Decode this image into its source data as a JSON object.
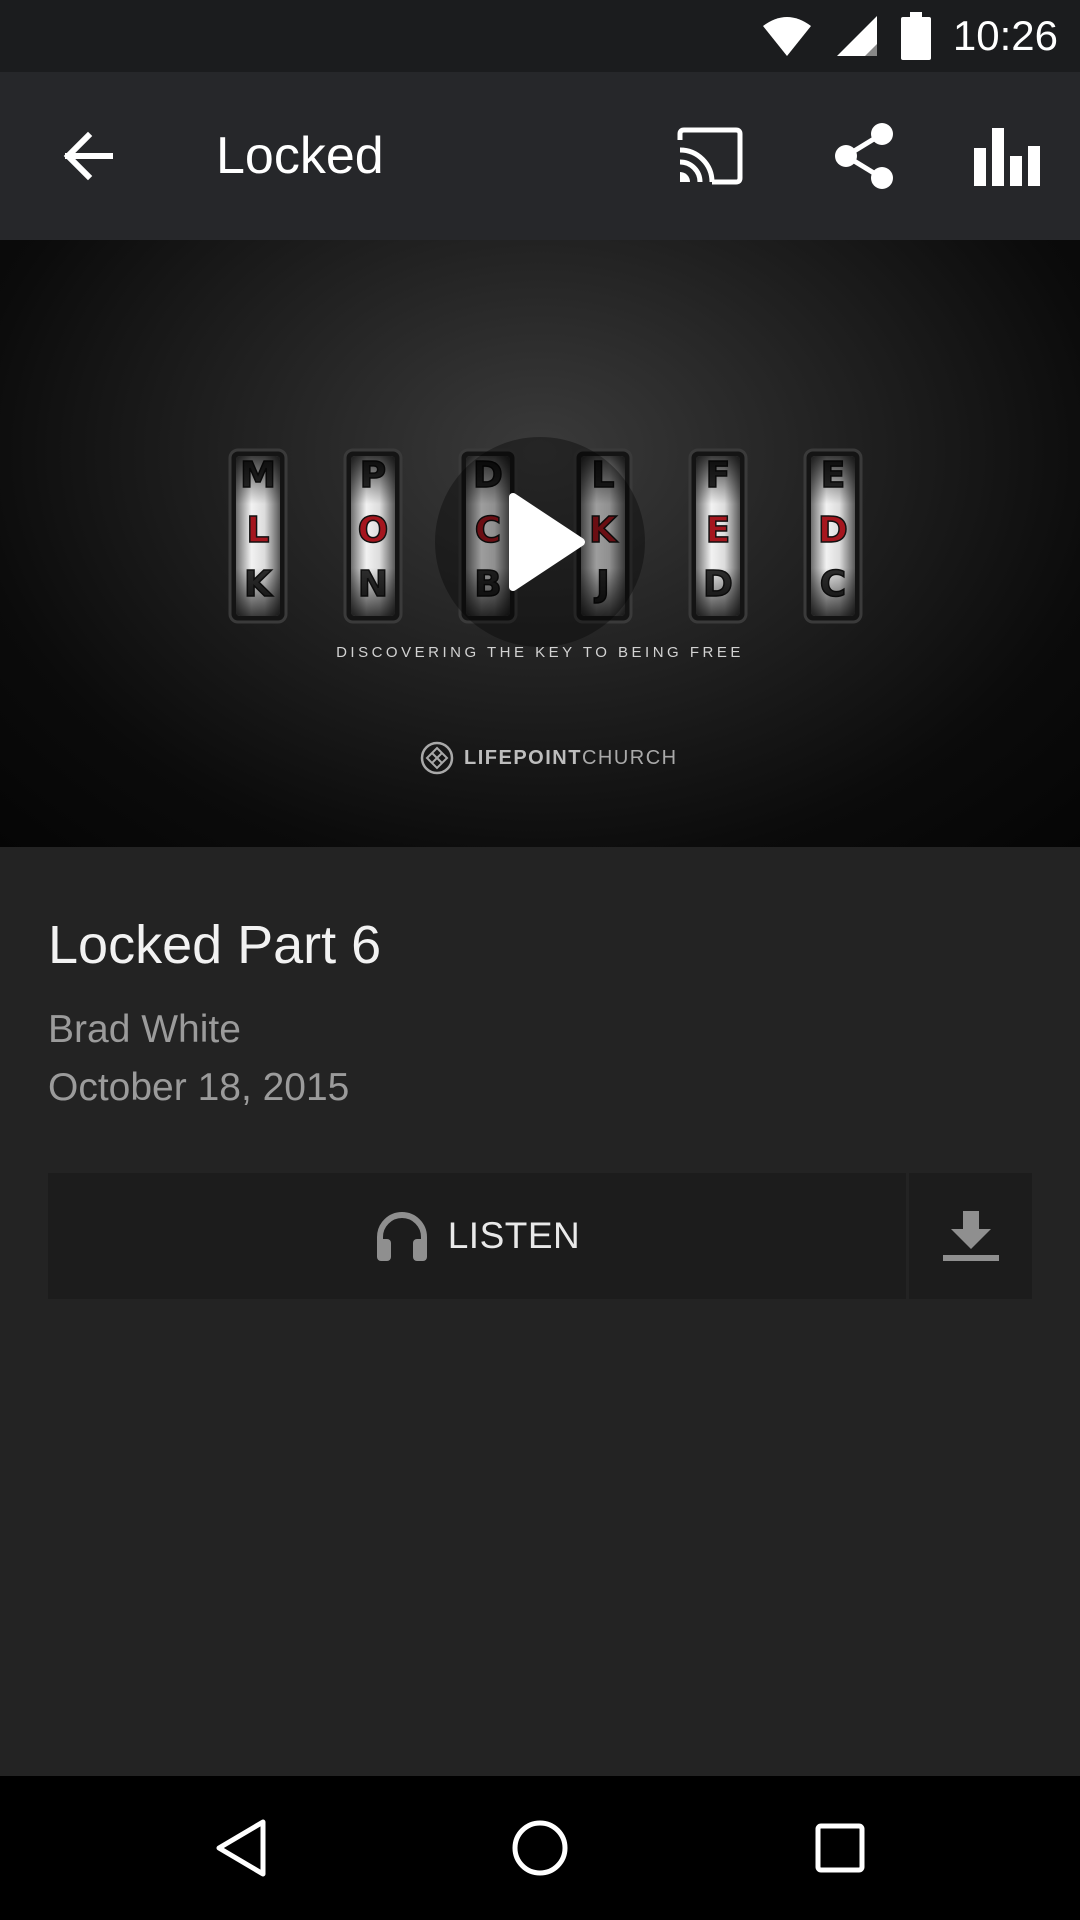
{
  "status_bar": {
    "time": "10:26"
  },
  "app_bar": {
    "title": "Locked",
    "icons": [
      "back-arrow-icon",
      "cast-icon",
      "share-icon",
      "equalizer-icon"
    ]
  },
  "hero": {
    "tumblers": [
      {
        "top": "M",
        "mid": "L",
        "bot": "K"
      },
      {
        "top": "P",
        "mid": "O",
        "bot": "N"
      },
      {
        "top": "D",
        "mid": "C",
        "bot": "B"
      },
      {
        "top": "L",
        "mid": "K",
        "bot": "J"
      },
      {
        "top": "F",
        "mid": "E",
        "bot": "D"
      },
      {
        "top": "E",
        "mid": "D",
        "bot": "C"
      }
    ],
    "tagline": "DISCOVERING THE KEY TO BEING FREE",
    "brand_bold": "LIFEPOINT",
    "brand_light": "CHURCH"
  },
  "sermon": {
    "title": "Locked Part 6",
    "speaker": "Brad White",
    "date": "October 18, 2015"
  },
  "actions": {
    "listen_label": "LISTEN",
    "listen_icon": "headphones-icon",
    "download_icon": "download-icon"
  },
  "colors": {
    "background": "#232323",
    "app_bar": "#26272a",
    "status_bar": "#1b1c1e",
    "button": "#1c1c1c",
    "tumbler_red": "#a5161e",
    "muted_text": "#9b9b9b"
  }
}
